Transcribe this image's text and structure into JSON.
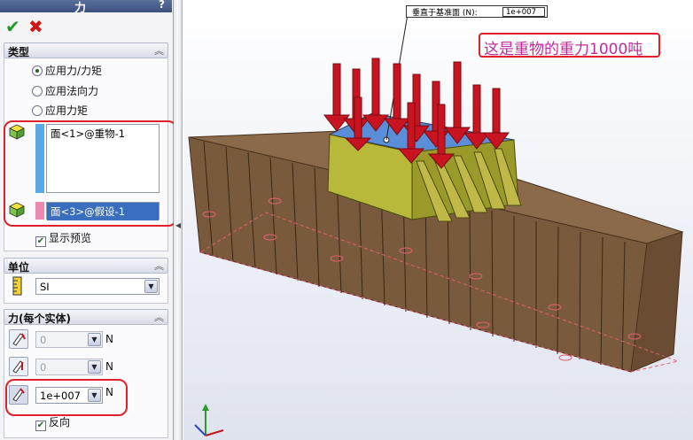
{
  "panel": {
    "title": "力",
    "help": "?",
    "ok_icon": "check-icon",
    "cancel_icon": "x-icon"
  },
  "type_section": {
    "header": "类型",
    "options": [
      "应用力/力矩",
      "应用法向力",
      "应用力矩"
    ],
    "selected_index": 0,
    "faces_list": [
      "面<1>@重物-1"
    ],
    "direction_list": [
      "面<3>@假设-1"
    ],
    "show_preview_label": "显示预览",
    "show_preview_checked": true
  },
  "unit_section": {
    "header": "单位",
    "unit_value": "SI"
  },
  "force_section": {
    "header": "力(每个实体)",
    "field1_value": "0",
    "field2_value": "0",
    "field3_value": "1e+007",
    "unit_label": "N",
    "reverse_label": "反向",
    "reverse_checked": true
  },
  "viewport": {
    "callout_label": "垂直于基准面 (N):",
    "callout_value": "1e+007",
    "annotation_text": "这是重物的重力1000吨"
  },
  "colors": {
    "highlight_frame": "#e0202a",
    "annotation_text": "#c02c9e",
    "force_arrow": "#c81420",
    "platform": "#8a6a4a",
    "load_block": "#b8b83a"
  }
}
